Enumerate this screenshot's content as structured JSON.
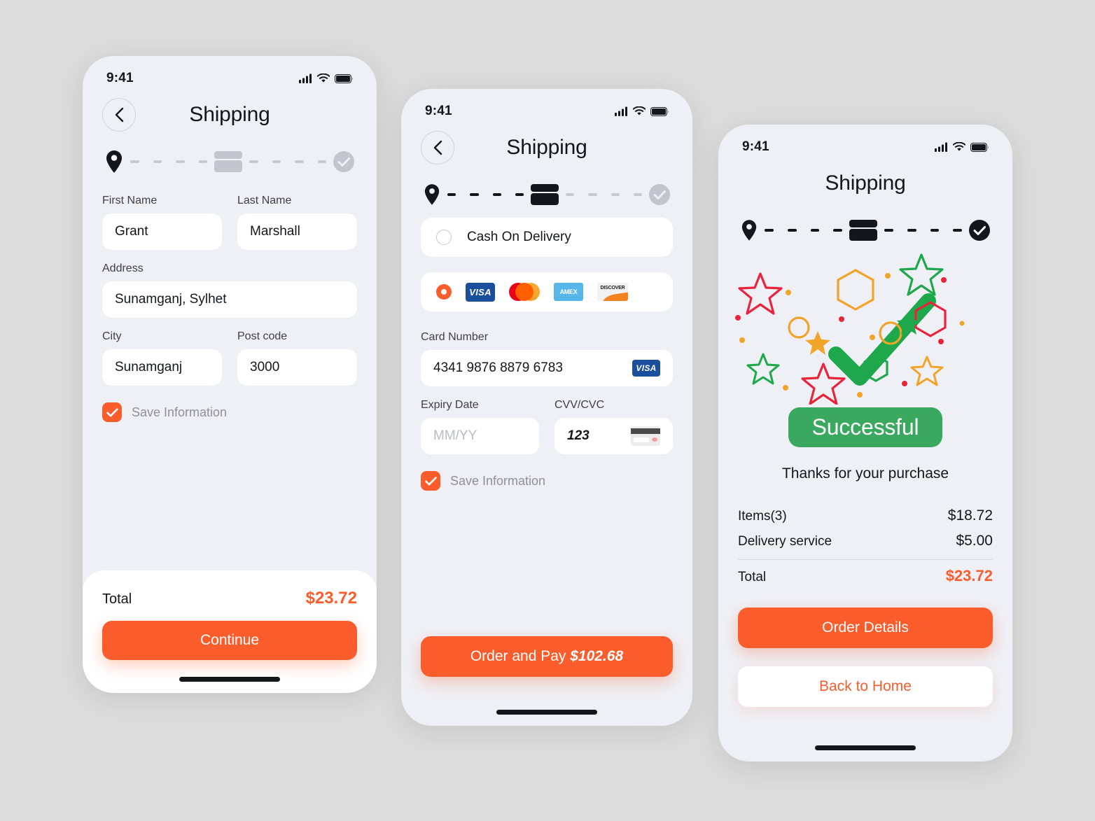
{
  "theme": {
    "accent": "#fa5c2b",
    "success": "#3aa95f",
    "page_bg": "#dcdcdc",
    "screen_bg": "#eff0f5",
    "ink": "#15161c"
  },
  "status_bar": {
    "time": "9:41"
  },
  "phone1": {
    "nav_title": "Shipping",
    "fields": {
      "first_name_label": "First Name",
      "first_name_value": "Grant",
      "last_name_label": "Last Name",
      "last_name_value": "Marshall",
      "address_label": "Address",
      "address_value": "Sunamganj, Sylhet",
      "city_label": "City",
      "city_value": "Sunamganj",
      "post_code_label": "Post code",
      "post_code_value": "3000"
    },
    "save_info_label": "Save Information",
    "total_label": "Total",
    "total_value": "$23.72",
    "continue_label": "Continue"
  },
  "phone2": {
    "nav_title": "Shipping",
    "cash_on_delivery_label": "Cash On Delivery",
    "brands": [
      "visa",
      "mastercard",
      "amex",
      "discover"
    ],
    "mastercard_word": "mastercard",
    "amex_word": "AMEX",
    "discover_word": "DISCOVER",
    "visa_word": "VISA",
    "card_number_label": "Card Number",
    "card_number_value": "4341 9876 8879 6783",
    "card_brand_badge": "VISA",
    "expiry_label": "Expiry Date",
    "expiry_placeholder": "MM/YY",
    "expiry_value": "",
    "cvv_label": "CVV/CVC",
    "cvv_value": "123",
    "save_info_label": "Save Information",
    "pay_button_text": "Order and Pay ",
    "pay_button_amount": "$102.68"
  },
  "phone3": {
    "nav_title": "Shipping",
    "badge_label": "Successful",
    "thanks_text": "Thanks for your purchase",
    "summary": [
      {
        "label": "Items(3)",
        "value": "$18.72"
      },
      {
        "label": "Delivery service",
        "value": "$5.00"
      }
    ],
    "total_label": "Total",
    "total_value": "$23.72",
    "order_details_label": "Order Details",
    "back_home_label": "Back to Home"
  }
}
